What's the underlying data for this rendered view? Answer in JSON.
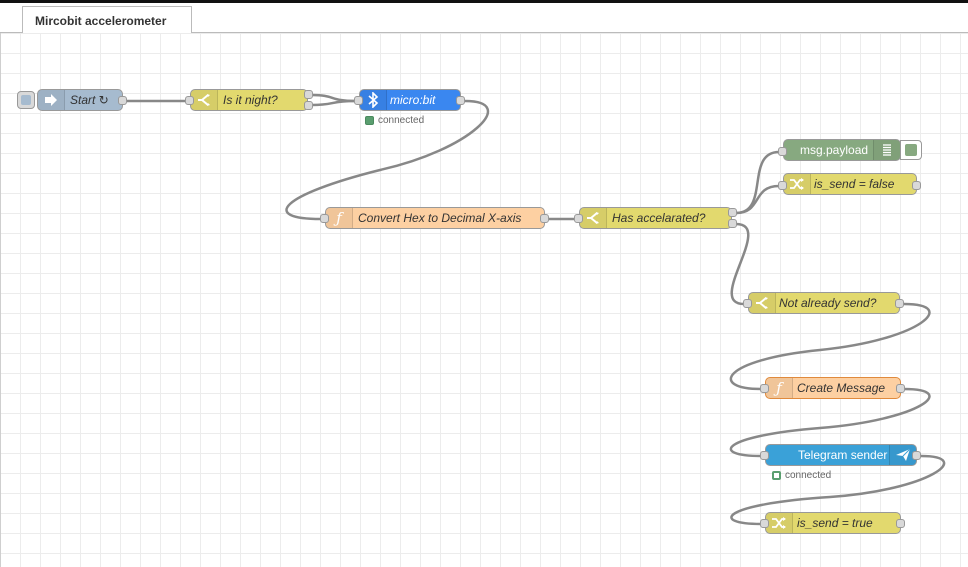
{
  "tab": {
    "title": "Mircobit accelerometer"
  },
  "colors": {
    "inject": "#a6bbcf",
    "switch": "#e2d96e",
    "function": "#fdd0a2",
    "microbit": "#3a87f0",
    "debug": "#87a980",
    "change": "#e2d96e",
    "telegram": "#3aa1d8",
    "wire": "#888888",
    "status_connected": "#5a9e6f"
  },
  "nodes": {
    "start": {
      "label": "Start ↻",
      "icon": "arrow-right-icon"
    },
    "is_night": {
      "label": "Is it night?",
      "icon": "switch-icon"
    },
    "microbit": {
      "label": "micro:bit",
      "icon": "bluetooth-icon",
      "status": "connected"
    },
    "convert_hex": {
      "label": "Convert Hex to Decimal X-axis",
      "icon": "function-icon"
    },
    "has_accelerated": {
      "label": "Has accelarated?",
      "icon": "switch-icon"
    },
    "msg_payload": {
      "label": "msg.payload",
      "icon": "list-icon"
    },
    "is_send_false": {
      "label": "is_send = false",
      "icon": "shuffle-icon"
    },
    "not_already_send": {
      "label": "Not already send?",
      "icon": "switch-icon"
    },
    "create_message": {
      "label": "Create Message",
      "icon": "function-icon"
    },
    "telegram_sender": {
      "label": "Telegram sender",
      "icon": "paper-plane-icon",
      "status": "connected"
    },
    "is_send_true": {
      "label": "is_send = true",
      "icon": "shuffle-icon"
    }
  }
}
